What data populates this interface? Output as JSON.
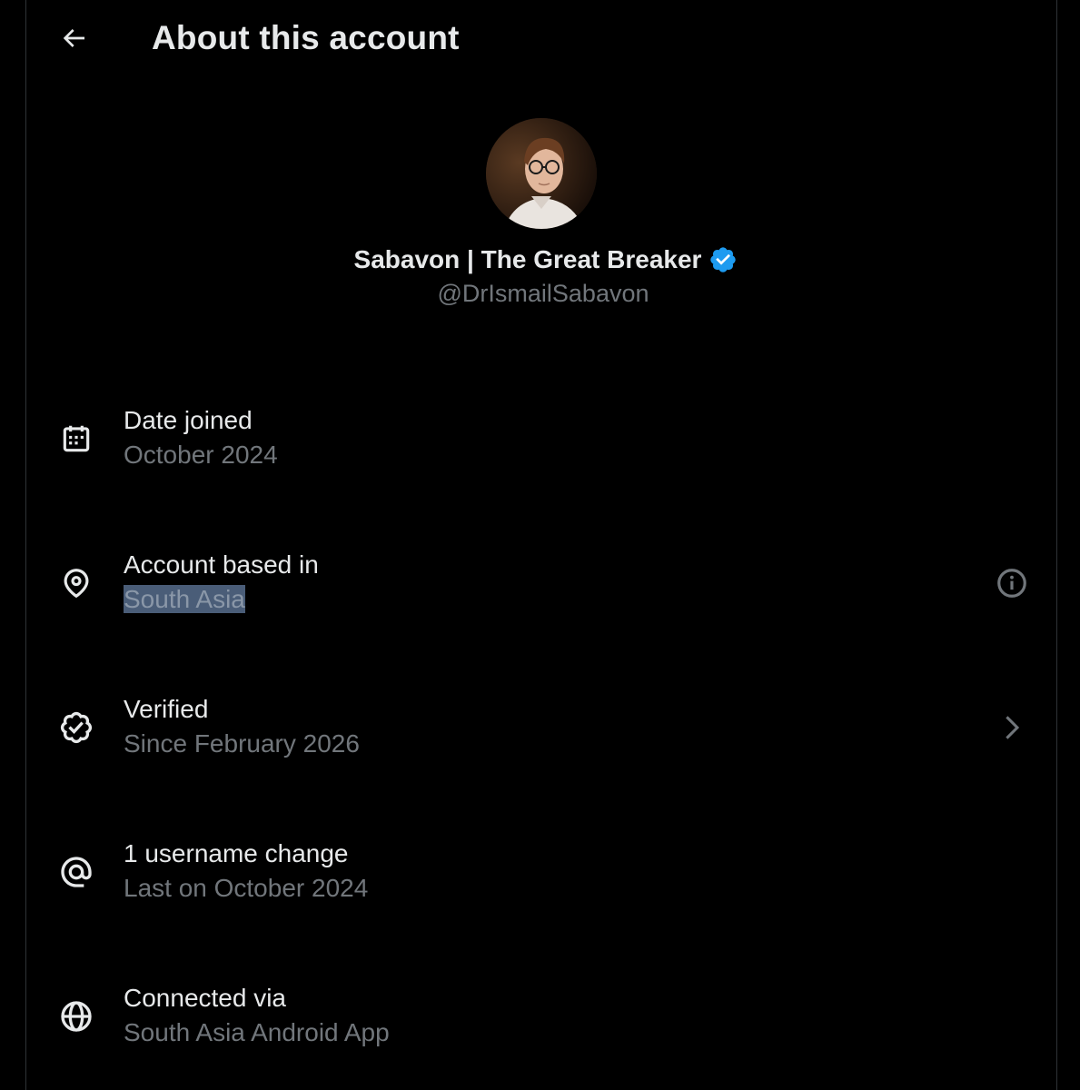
{
  "header": {
    "back_icon": "arrow-left-icon",
    "title": "About this account"
  },
  "profile": {
    "display_name": "Sabavon | The Great Breaker",
    "handle": "@DrIsmailSabavon",
    "verified_badge_color": "#1d9bf0"
  },
  "rows": [
    {
      "icon": "calendar-icon",
      "label": "Date joined",
      "value": "October 2024"
    },
    {
      "icon": "location-pin-icon",
      "label": "Account based in",
      "value": "South Asia",
      "action_icon": "info-icon"
    },
    {
      "icon": "verified-check-icon",
      "label": "Verified",
      "value": "Since February 2026",
      "action_icon": "chevron-right-icon"
    },
    {
      "icon": "at-sign-icon",
      "label": "1 username change",
      "value": "Last on October 2024"
    },
    {
      "icon": "globe-icon",
      "label": "Connected via",
      "value": "South Asia Android App"
    }
  ],
  "colors": {
    "background": "#000000",
    "primary_text": "#e7e9ea",
    "secondary_text": "#71767b",
    "selection_highlight": "#4a5d78"
  }
}
